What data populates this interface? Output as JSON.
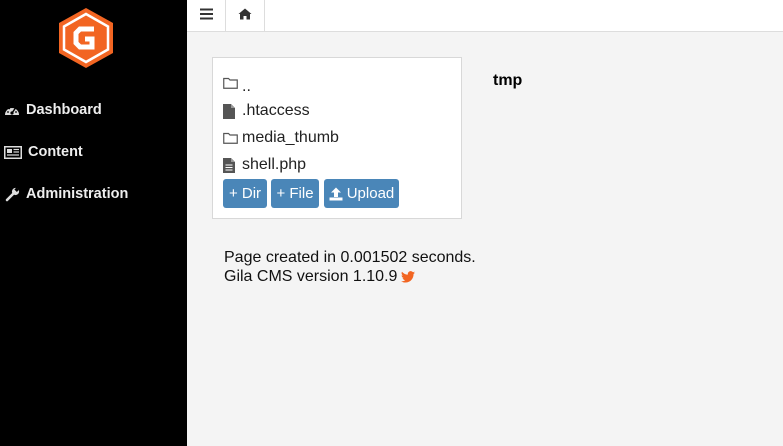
{
  "sidebar": {
    "logo": "gila-logo",
    "items": [
      {
        "label": "Dashboard",
        "icon": "dashboard-icon"
      },
      {
        "label": "Content",
        "icon": "content-icon"
      },
      {
        "label": "Administration",
        "icon": "wrench-icon"
      }
    ]
  },
  "topbar": {
    "menu_icon": "menu-icon",
    "home_icon": "home-icon"
  },
  "file_browser": {
    "path": "tmp",
    "entries": [
      {
        "name": "..",
        "type": "folder"
      },
      {
        "name": ".htaccess",
        "type": "file"
      },
      {
        "name": "media_thumb",
        "type": "folder"
      },
      {
        "name": "shell.php",
        "type": "file"
      }
    ],
    "buttons": {
      "add_dir": "+ Dir",
      "add_file": "+ File",
      "upload": "Upload"
    }
  },
  "footer": {
    "page_created": "Page created in 0.001502 seconds.",
    "version": "Gila CMS version 1.10.9"
  },
  "colors": {
    "sidebar_bg": "#000000",
    "accent_orange": "#f26522",
    "button_blue": "#4a86b8"
  }
}
